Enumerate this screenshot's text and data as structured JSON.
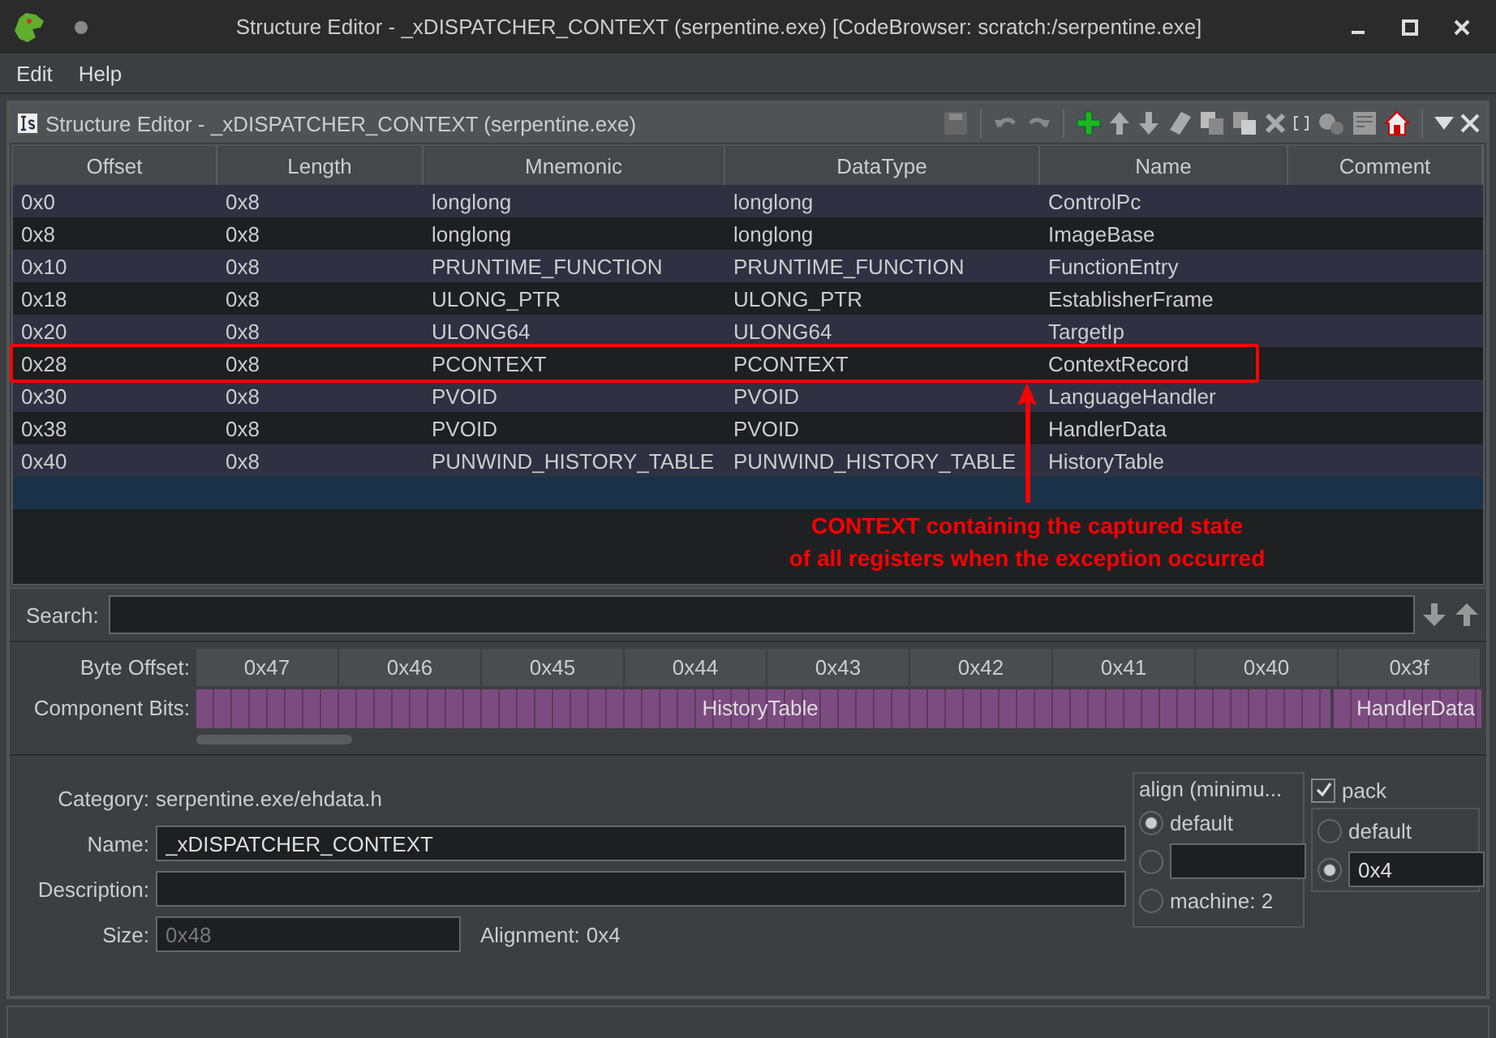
{
  "window": {
    "title": "Structure Editor - _xDISPATCHER_CONTEXT (serpentine.exe) [CodeBrowser: scratch:/serpentine.exe]"
  },
  "menu": [
    "Edit",
    "Help"
  ],
  "panel": {
    "title": "Structure Editor - _xDISPATCHER_CONTEXT (serpentine.exe)"
  },
  "table": {
    "columns": [
      "Offset",
      "Length",
      "Mnemonic",
      "DataType",
      "Name",
      "Comment"
    ],
    "rows": [
      {
        "cells": [
          "0x0",
          "0x8",
          "longlong",
          "longlong",
          "ControlPc"
        ]
      },
      {
        "cells": [
          "0x8",
          "0x8",
          "longlong",
          "longlong",
          "ImageBase"
        ]
      },
      {
        "cells": [
          "0x10",
          "0x8",
          "PRUNTIME_FUNCTION",
          "PRUNTIME_FUNCTION",
          "FunctionEntry"
        ]
      },
      {
        "cells": [
          "0x18",
          "0x8",
          "ULONG_PTR",
          "ULONG_PTR",
          "EstablisherFrame"
        ]
      },
      {
        "cells": [
          "0x20",
          "0x8",
          "ULONG64",
          "ULONG64",
          "TargetIp"
        ]
      },
      {
        "cells": [
          "0x28",
          "0x8",
          "PCONTEXT",
          "PCONTEXT",
          "ContextRecord"
        ]
      },
      {
        "cells": [
          "0x30",
          "0x8",
          "PVOID",
          "PVOID",
          "LanguageHandler"
        ]
      },
      {
        "cells": [
          "0x38",
          "0x8",
          "PVOID",
          "PVOID",
          "HandlerData"
        ]
      },
      {
        "cells": [
          "0x40",
          "0x8",
          "PUNWIND_HISTORY_TABLE",
          "PUNWIND_HISTORY_TABLE",
          "HistoryTable"
        ]
      }
    ]
  },
  "annotation": {
    "lines": [
      "CONTEXT containing the captured state",
      "of all registers when the exception occurred"
    ]
  },
  "search": {
    "label": "Search:"
  },
  "bit_view": {
    "byte_offset_label": "Byte Offset:",
    "byte_offsets": [
      "0x47",
      "0x46",
      "0x45",
      "0x44",
      "0x43",
      "0x42",
      "0x41",
      "0x40",
      "0x3f"
    ],
    "component_bits_label": "Component Bits:",
    "components": [
      "HistoryTable",
      "HandlerData"
    ]
  },
  "form": {
    "category_label": "Category:",
    "category": "serpentine.exe/ehdata.h",
    "name_label": "Name:",
    "name": "_xDISPATCHER_CONTEXT",
    "description_label": "Description:",
    "size_label": "Size:",
    "size": "0x48",
    "alignment_label": "Alignment:",
    "alignment": "0x4",
    "align": {
      "title": "align (minimu...",
      "options": [
        {
          "kind": "label",
          "label": "default",
          "selected": true
        },
        {
          "kind": "field",
          "selected": false
        },
        {
          "kind": "label",
          "label": "machine: 2",
          "selected": false
        }
      ]
    },
    "pack": {
      "label": "pack",
      "checked": true,
      "options": [
        {
          "kind": "label",
          "label": "default",
          "selected": false
        },
        {
          "kind": "field",
          "value": "0x4",
          "selected": true
        }
      ]
    }
  }
}
